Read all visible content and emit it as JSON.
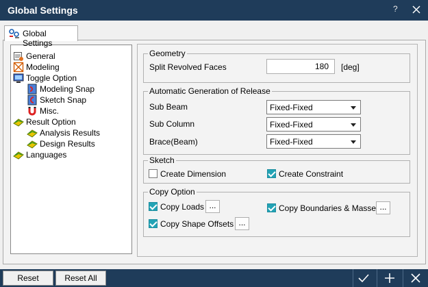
{
  "window": {
    "title": "Global Settings",
    "help": "?"
  },
  "tab": {
    "label": "Global Settings"
  },
  "tree": [
    {
      "label": "General",
      "icon": "general-icon"
    },
    {
      "label": "Modeling",
      "icon": "modeling-icon"
    },
    {
      "label": "Toggle Option",
      "icon": "toggle-option-icon"
    },
    {
      "label": "Modeling Snap",
      "icon": "modeling-snap-icon"
    },
    {
      "label": "Sketch Snap",
      "icon": "sketch-snap-icon"
    },
    {
      "label": "Misc.",
      "icon": "magnet-icon"
    },
    {
      "label": "Result Option",
      "icon": "result-option-icon"
    },
    {
      "label": "Analysis Results",
      "icon": "analysis-results-icon"
    },
    {
      "label": "Design Results",
      "icon": "design-results-icon"
    },
    {
      "label": "Languages",
      "icon": "languages-icon"
    }
  ],
  "geometry": {
    "title": "Geometry",
    "split_label": "Split Revolved Faces",
    "split_value": "180",
    "split_unit": "[deg]"
  },
  "release": {
    "title": "Automatic Generation of Release",
    "sub_beam_label": "Sub Beam",
    "sub_beam_value": "Fixed-Fixed",
    "sub_column_label": "Sub Column",
    "sub_column_value": "Fixed-Fixed",
    "brace_label": "Brace(Beam)",
    "brace_value": "Fixed-Fixed"
  },
  "sketch": {
    "title": "Sketch",
    "create_dimension": "Create Dimension",
    "create_dimension_checked": false,
    "create_constraint": "Create Constraint",
    "create_constraint_checked": true
  },
  "copy": {
    "title": "Copy Option",
    "copy_loads": "Copy Loads",
    "copy_boundaries": "Copy Boundaries & Masses",
    "copy_shape_offsets": "Copy Shape Offsets",
    "ellipsis": "..."
  },
  "footer": {
    "reset": "Reset",
    "reset_all": "Reset All"
  },
  "colors": {
    "titlebar": "#1f3c5a",
    "accent_check": "#23a3b5"
  }
}
